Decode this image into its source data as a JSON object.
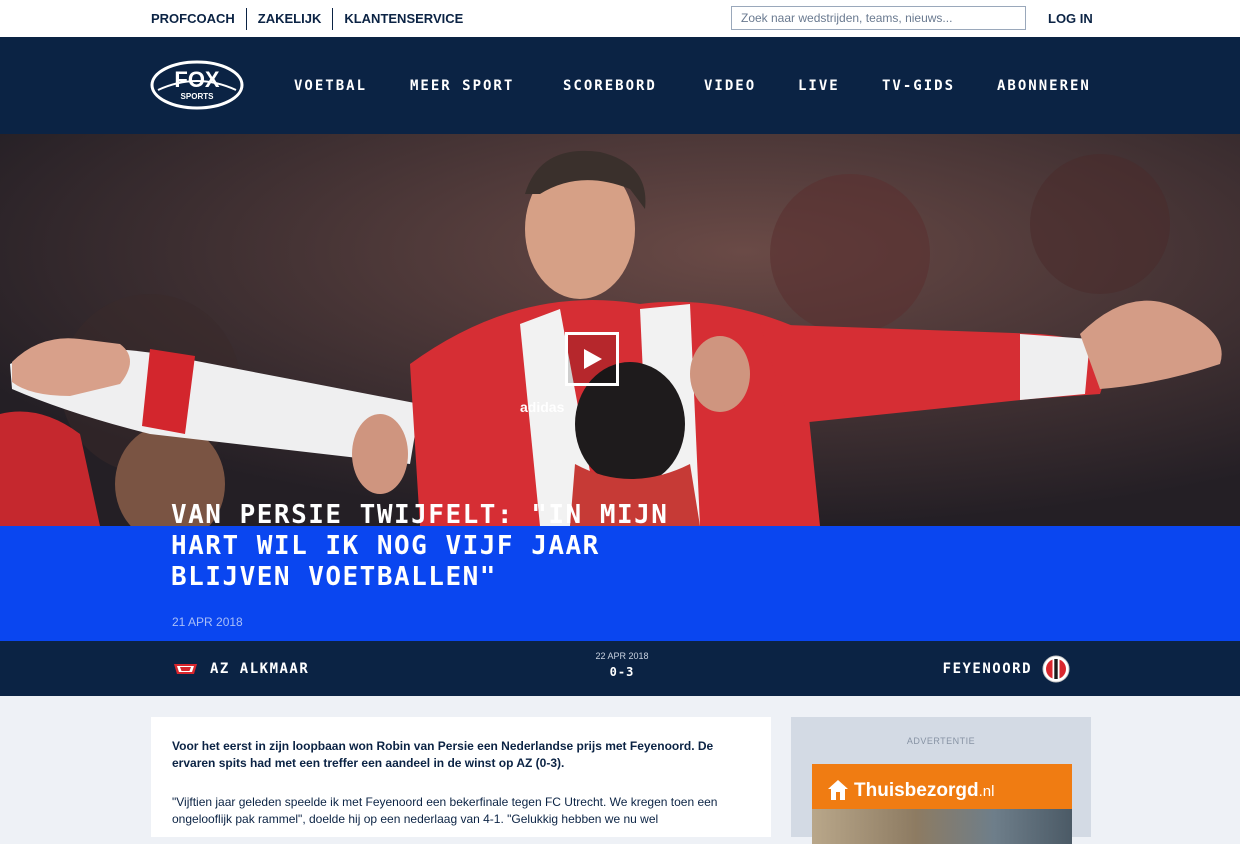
{
  "topbar": {
    "links": [
      "PROFCOACH",
      "ZAKELIJK",
      "KLANTENSERVICE"
    ],
    "search_placeholder": "Zoek naar wedstrijden, teams, nieuws...",
    "login_label": "LOG IN"
  },
  "brand": {
    "logo_text_top": "FOX",
    "logo_text_bottom": "SPORTS"
  },
  "nav": {
    "items": [
      "VOETBAL",
      "MEER SPORT",
      "SCOREBORD",
      "VIDEO",
      "LIVE",
      "TV-GIDS",
      "ABONNEREN"
    ]
  },
  "hero": {
    "play_icon": "play-icon",
    "shirt_brand": "adidas"
  },
  "article": {
    "headline": "Van Persie twijfelt: \"In mijn hart wil ik nog vijf jaar blijven voetballen\"",
    "date": "21 APR 2018",
    "lead": "Voor het eerst in zijn loopbaan won Robin van Persie een Nederlandse prijs met Feyenoord. De ervaren spits had met een treffer een aandeel in de winst op AZ (0-3).",
    "paragraph": "\"Vijftien jaar geleden speelde ik met Feyenoord een bekerfinale tegen FC Utrecht. We kregen toen een ongelooflijk pak rammel\", doelde hij op een nederlaag van 4-1. \"Gelukkig hebben we nu wel"
  },
  "match": {
    "home_team": "AZ ALKMAAR",
    "away_team": "FEYENOORD",
    "date": "22 APR 2018",
    "score": "0-3"
  },
  "ad": {
    "label": "ADVERTENTIE",
    "brand_name": "Thuisbezorgd",
    "brand_suffix": ".nl"
  },
  "colors": {
    "navy": "#0b2344",
    "headline_blue": "#0a46f0",
    "ad_orange": "#f07c12",
    "page_bg": "#eef1f6"
  }
}
